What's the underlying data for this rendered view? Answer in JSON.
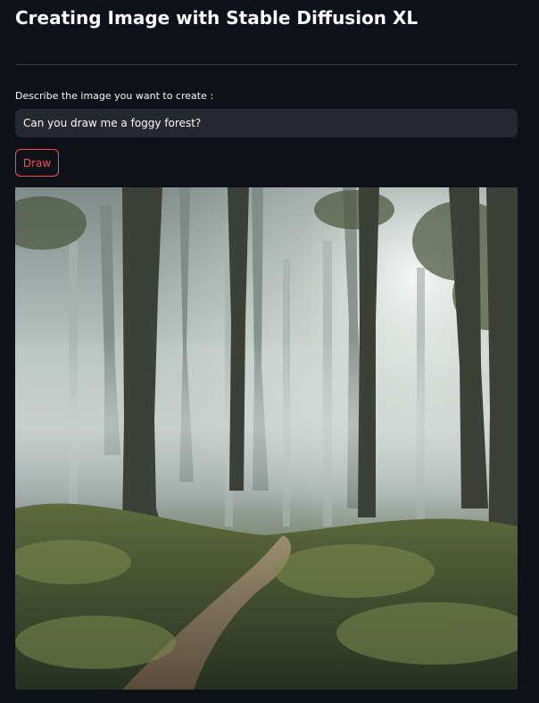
{
  "header": {
    "title": "Creating Image with Stable Diffusion XL"
  },
  "prompt": {
    "label": "Describe the image you want to create :",
    "value": "Can you draw me a foggy forest?"
  },
  "actions": {
    "draw_label": "Draw"
  },
  "colors": {
    "background": "#0e1117",
    "input_background": "#262730",
    "accent": "#ff4b4b",
    "text": "#fafafa"
  },
  "icons": {
    "generated_image": "foggy-forest-image"
  }
}
